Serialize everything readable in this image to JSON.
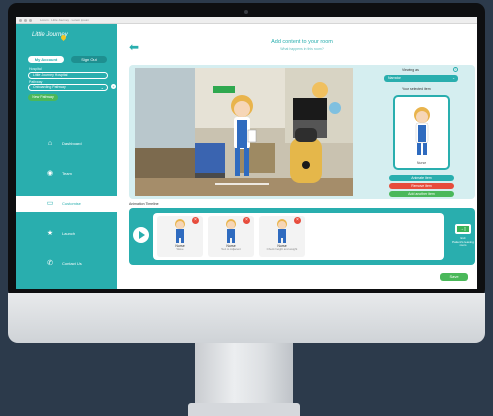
{
  "browser": {
    "url": "Lorem · Little Journey · Lorem ipsum"
  },
  "sidebar": {
    "logo": "Little Journey",
    "my_account": "My Account",
    "sign_out": "Sign Out",
    "hospital_label": "Hospital",
    "hospital_value": "Little Journey Hospital",
    "pathway_label": "Pathway",
    "pathway_value": "Onboarding Pathway",
    "new_pathway": "New Pathway",
    "nav": [
      {
        "label": "Dashboard",
        "icon": "home-icon"
      },
      {
        "label": "Team",
        "icon": "user-icon"
      },
      {
        "label": "Customise",
        "icon": "tablet-icon"
      },
      {
        "label": "Launch",
        "icon": "star-icon"
      },
      {
        "label": "Contact Us",
        "icon": "phone-icon"
      }
    ]
  },
  "main": {
    "title": "Add content to your room",
    "subtitle": "What happens in this room?",
    "viewing_as_label": "Viewing as",
    "viewing_as_value": "Narrator",
    "selected_item_label": "Your selected item",
    "selected_item_caption": "Nurse",
    "actions": {
      "animate": "Animate item",
      "remove": "Remove item",
      "add": "Add another item"
    },
    "timeline_label": "Animation Timeline",
    "timeline_cards": [
      {
        "name": "Nurse",
        "desc": "Wave"
      },
      {
        "name": "Nurse",
        "desc": "Text to Adjacent"
      },
      {
        "name": "Nurse",
        "desc": "Check height and weight"
      }
    ],
    "exit_label": "Exit",
    "exit_desc": "Patient's leaving room",
    "save": "Save"
  },
  "colors": {
    "teal": "#29aeae",
    "green": "#4ab85a",
    "red": "#e74c3c",
    "room_bg": "#d5eef0"
  }
}
